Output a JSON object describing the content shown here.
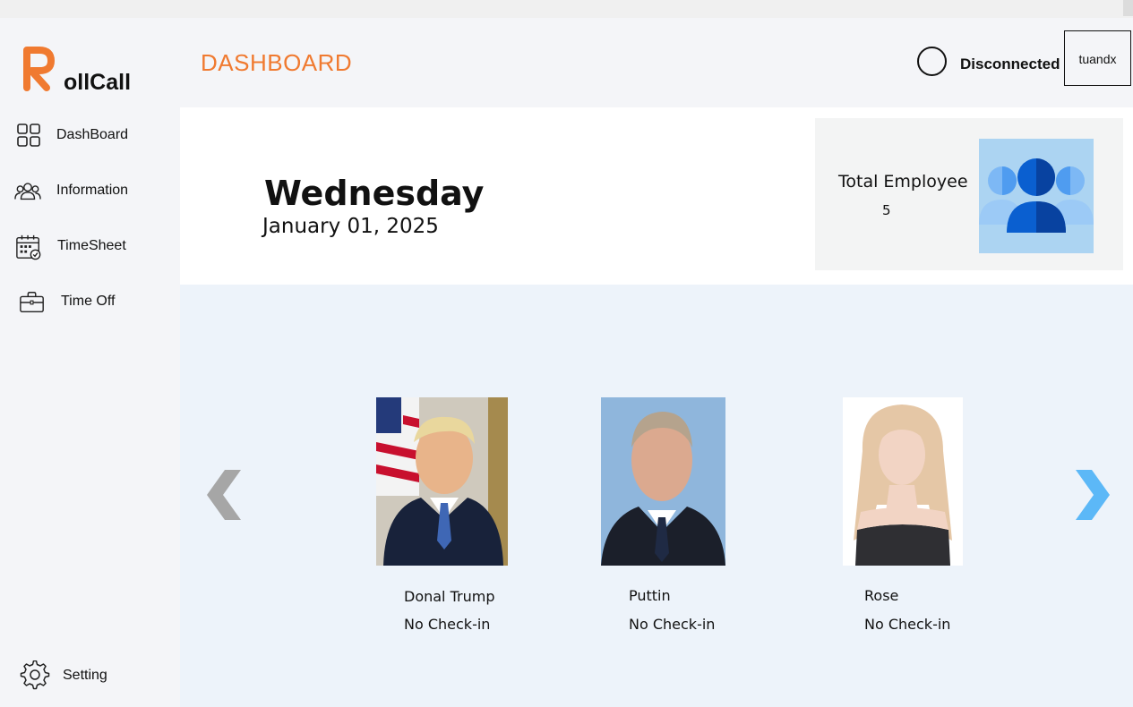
{
  "app": {
    "logo_letter": "R",
    "logo_text": "ollCall",
    "brand_color": "#f07a30"
  },
  "sidebar": {
    "items": [
      {
        "label": "DashBoard",
        "icon": "grid-icon"
      },
      {
        "label": "Information",
        "icon": "users-icon"
      },
      {
        "label": "TimeSheet",
        "icon": "calendar-check-icon"
      },
      {
        "label": "Time Off",
        "icon": "briefcase-icon"
      }
    ],
    "setting": {
      "label": "Setting",
      "icon": "gear-icon"
    }
  },
  "header": {
    "title": "DASHBOARD",
    "status": "Disconnected",
    "user": "tuandx"
  },
  "today": {
    "day": "Wednesday",
    "date": "January 01, 2025"
  },
  "stats": {
    "total_label": "Total Employee",
    "total_value": "5"
  },
  "employees": [
    {
      "name": "Donal Trump",
      "status": "No Check-in"
    },
    {
      "name": "Puttin",
      "status": "No Check-in"
    },
    {
      "name": "Rose",
      "status": "No Check-in"
    }
  ],
  "colors": {
    "accent": "#f07a30",
    "arrow_left": "#a6a6a6",
    "arrow_right": "#5cb8f7",
    "carousel_bg": "#edf3fa"
  }
}
